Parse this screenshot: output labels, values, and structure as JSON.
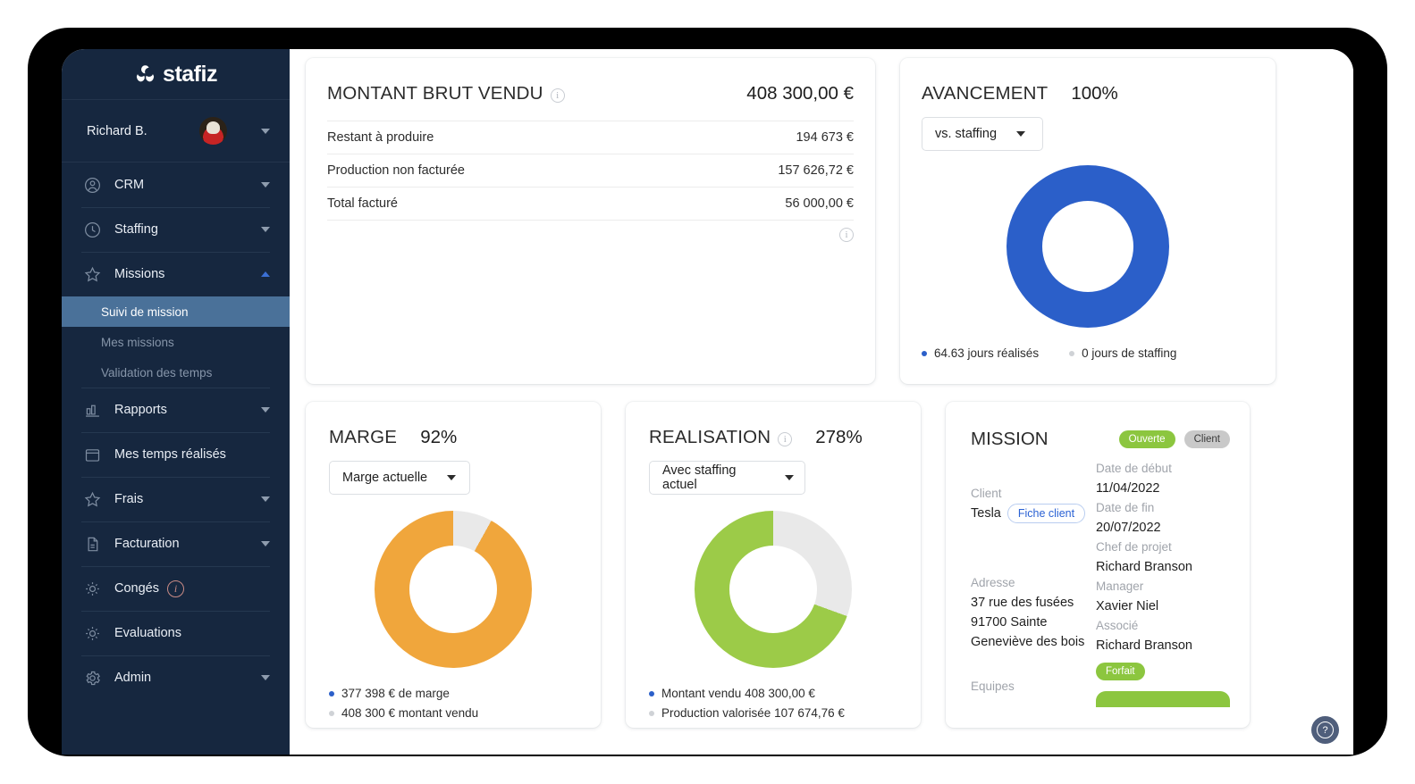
{
  "brand": {
    "name": "stafiz"
  },
  "sidebar": {
    "user": {
      "name": "Richard B."
    },
    "items": [
      {
        "label": "CRM",
        "icon": "user-circle-icon",
        "caret": "down"
      },
      {
        "label": "Staffing",
        "icon": "clock-icon",
        "caret": "down"
      },
      {
        "label": "Missions",
        "icon": "star-icon",
        "caret": "up"
      },
      {
        "label": "Rapports",
        "icon": "bar-chart-icon",
        "caret": "down"
      },
      {
        "label": "Mes temps réalisés",
        "icon": "calendar-icon",
        "caret": "none"
      },
      {
        "label": "Frais",
        "icon": "star-icon",
        "caret": "down"
      },
      {
        "label": "Facturation",
        "icon": "document-icon",
        "caret": "down"
      },
      {
        "label": "Congés",
        "icon": "sun-icon",
        "caret": "none",
        "badge": "i"
      },
      {
        "label": "Evaluations",
        "icon": "sun-icon",
        "caret": "none"
      },
      {
        "label": "Admin",
        "icon": "gear-icon",
        "caret": "down"
      }
    ],
    "submenu": [
      {
        "label": "Suivi de mission",
        "active": true
      },
      {
        "label": "Mes missions",
        "active": false
      },
      {
        "label": "Validation des temps",
        "active": false
      }
    ]
  },
  "brut": {
    "title": "MONTANT BRUT VENDU",
    "total": "408 300,00 €",
    "rows": [
      {
        "label": "Restant à produire",
        "amount": "194 673 €"
      },
      {
        "label": "Production non facturée",
        "amount": "157 626,72 €"
      },
      {
        "label": "Total facturé",
        "amount": "56 000,00 €"
      }
    ]
  },
  "avancement": {
    "title": "AVANCEMENT",
    "percent": "100%",
    "select": "vs. staffing",
    "legend": [
      {
        "text": "64.63 jours réalisés",
        "color": "#2b5fc9"
      },
      {
        "text": "0 jours de staffing",
        "color": "#cfd2d6"
      }
    ]
  },
  "marge": {
    "title": "MARGE",
    "percent": "92%",
    "select": "Marge actuelle",
    "legend": [
      {
        "text": "377 398 € de marge",
        "color": "#2b5fc9"
      },
      {
        "text": "408 300 € montant vendu",
        "color": "#cfd2d6"
      }
    ]
  },
  "realisation": {
    "title": "REALISATION",
    "percent": "278%",
    "select": "Avec staffing actuel",
    "legend": [
      {
        "text": "Montant vendu 408 300,00 €",
        "color": "#2b5fc9"
      },
      {
        "text": "Production valorisée 107 674,76 €",
        "color": "#cfd2d6"
      }
    ]
  },
  "mission": {
    "title": "MISSION",
    "status_badge": "Ouverte",
    "type_badge": "Client",
    "client_label": "Client",
    "client_value": "Tesla",
    "client_button": "Fiche client",
    "address_label": "Adresse",
    "address_line1": "37 rue des fusées",
    "address_line2": "91700  Sainte",
    "address_line3": "Geneviève des bois",
    "teams_label": "Equipes",
    "start_label": "Date de début",
    "start_value": "11/04/2022",
    "end_label": "Date de fin",
    "end_value": "20/07/2022",
    "pm_label": "Chef de projet",
    "pm_value": "Richard Branson",
    "manager_label": "Manager",
    "manager_value": "Xavier Niel",
    "partner_label": "Associé",
    "partner_value": "Richard Branson",
    "forfait_badge": "Forfait"
  },
  "help": {
    "label": "?"
  },
  "chart_data": [
    {
      "type": "pie",
      "title": "AVANCEMENT",
      "subtitle": "100%",
      "categories": [
        "64.63 jours réalisés",
        "0 jours de staffing"
      ],
      "values": [
        100,
        0
      ],
      "colors": [
        "#2b5fc9",
        "#e8e8e8"
      ],
      "legend": "bottom"
    },
    {
      "type": "pie",
      "title": "MARGE",
      "subtitle": "92%",
      "categories": [
        "377 398 € de marge",
        "408 300 € montant vendu"
      ],
      "values": [
        92,
        8
      ],
      "colors": [
        "#f0a63c",
        "#e8e8e8"
      ],
      "legend": "bottom"
    },
    {
      "type": "pie",
      "title": "REALISATION",
      "subtitle": "278%",
      "categories": [
        "Montant vendu 408 300,00 €",
        "Production valorisée 107 674,76 €"
      ],
      "values": [
        70,
        30
      ],
      "colors": [
        "#9ccb48",
        "#e8e8e8"
      ],
      "legend": "bottom"
    }
  ]
}
